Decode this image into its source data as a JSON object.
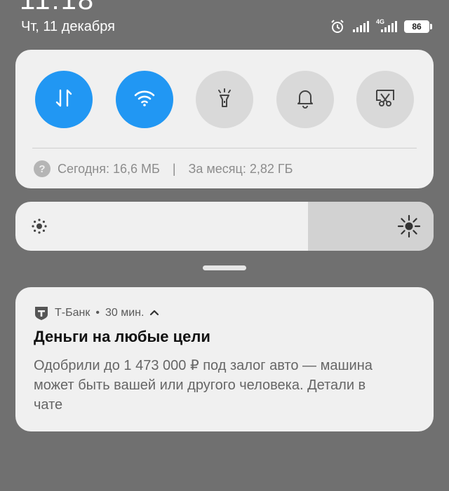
{
  "status_bar": {
    "time_partial": "11:18",
    "date": "Чт, 11 декабря",
    "network_label": "4G",
    "battery_level": "86"
  },
  "quick_settings": {
    "toggles": [
      {
        "name": "mobile-data",
        "icon": "data-transfer-icon",
        "state": "on"
      },
      {
        "name": "wifi",
        "icon": "wifi-icon",
        "state": "on"
      },
      {
        "name": "flashlight",
        "icon": "flashlight-icon",
        "state": "off"
      },
      {
        "name": "notifications",
        "icon": "bell-icon",
        "state": "off"
      },
      {
        "name": "screenshot",
        "icon": "scissors-icon",
        "state": "off"
      }
    ],
    "usage_today": "Сегодня: 16,6 МБ",
    "usage_separator": "|",
    "usage_month": "За месяц: 2,82 ГБ"
  },
  "brightness": {
    "level_fraction": 0.7
  },
  "notification": {
    "app_name": "Т-Банк",
    "dot": "•",
    "time": "30 мин.",
    "title": "Деньги на любые цели",
    "body": "Одобрили до 1 473 000 ₽ под залог авто — машина может быть вашей или другого человека. Детали в чате"
  },
  "colors": {
    "accent": "#2197f3",
    "panel_bg": "#f0f0f0",
    "screen_bg": "#707070"
  }
}
